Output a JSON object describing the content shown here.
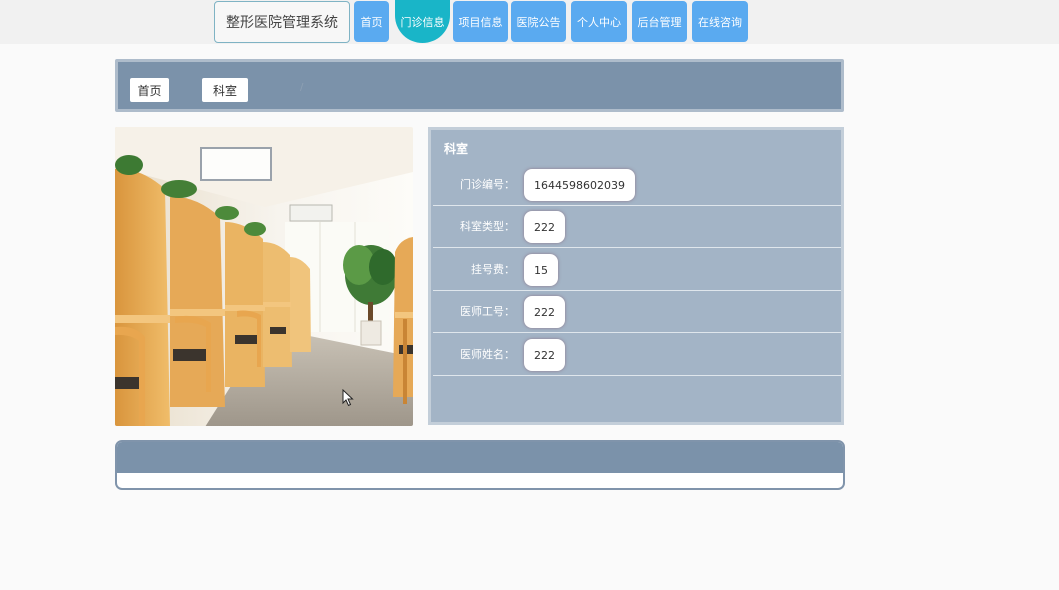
{
  "header": {
    "brand": "整形医院管理系统",
    "nav": [
      {
        "label": "首页",
        "active": false
      },
      {
        "label": "门诊信息",
        "active": true
      },
      {
        "label": "项目信息",
        "active": false
      },
      {
        "label": "医院公告",
        "active": false
      },
      {
        "label": "个人中心",
        "active": false
      },
      {
        "label": "后台管理",
        "active": false
      },
      {
        "label": "在线咨询",
        "active": false
      }
    ]
  },
  "breadcrumb": {
    "home": "首页",
    "current": "科室"
  },
  "detail": {
    "title": "科室",
    "fields": [
      {
        "label": "门诊编号：",
        "value": "1644598602039"
      },
      {
        "label": "科室类型：",
        "value": "222"
      },
      {
        "label": "挂号费：",
        "value": "15"
      },
      {
        "label": "医师工号：",
        "value": "222"
      },
      {
        "label": "医师姓名：",
        "value": "222"
      }
    ]
  },
  "colors": {
    "nav": "#5aaaf0",
    "nav_active": "#19b5c8",
    "panel_header": "#7b92aa",
    "detail_bg": "#a3b4c6"
  }
}
